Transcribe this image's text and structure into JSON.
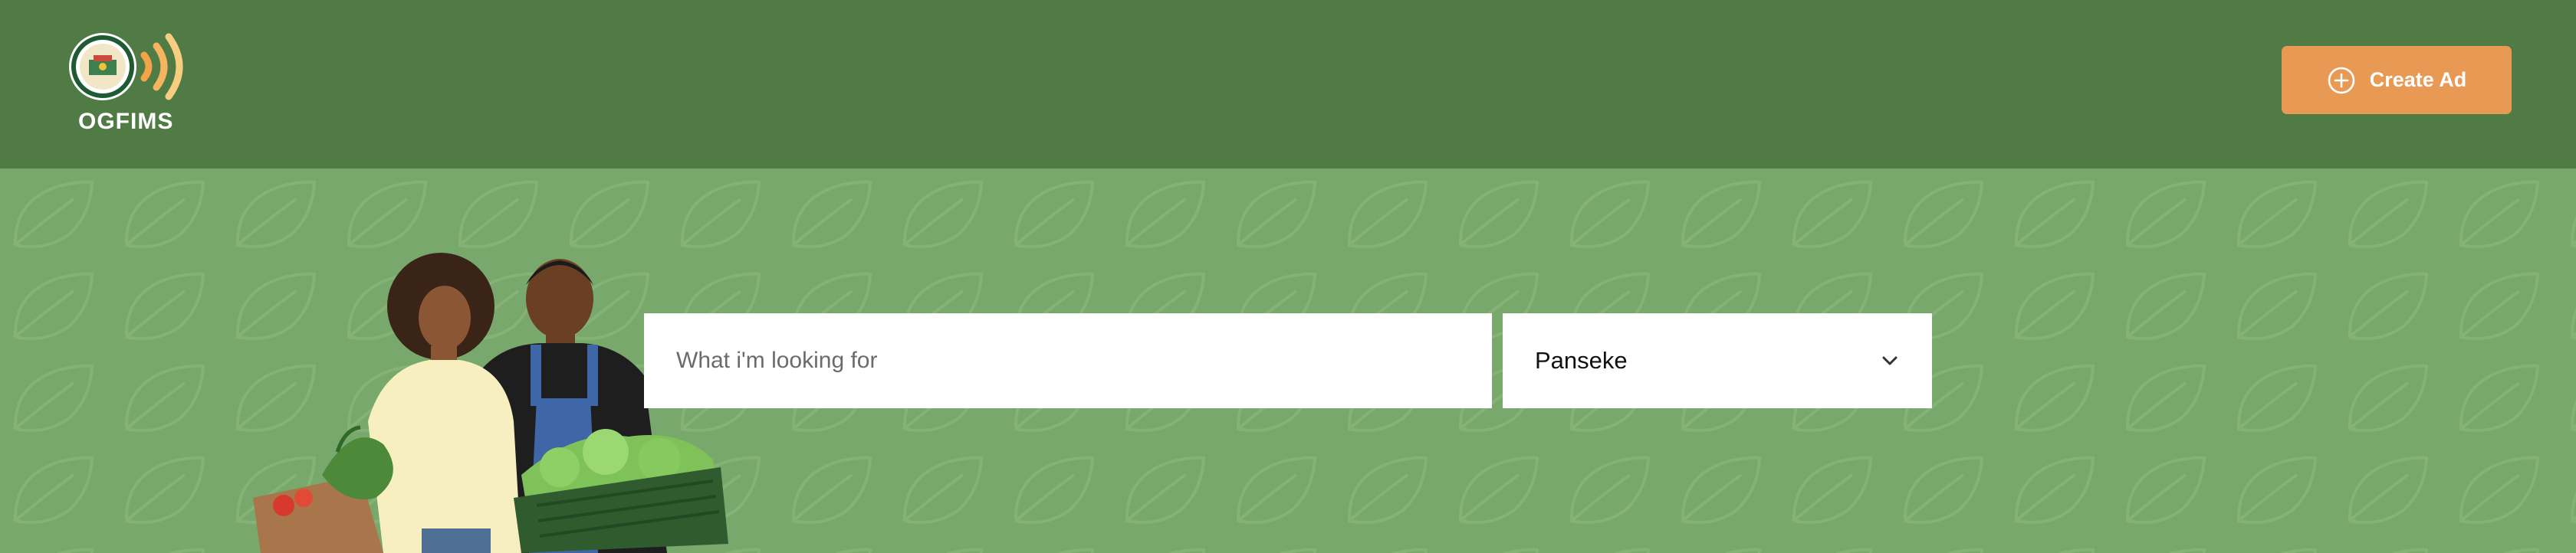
{
  "header": {
    "brand_name": "OGFIMS",
    "create_ad_label": "Create Ad"
  },
  "search": {
    "placeholder": "What i'm looking for",
    "value": ""
  },
  "location": {
    "selected": "Panseke"
  },
  "icons": {
    "create_ad": "plus-circle-icon",
    "location_dropdown": "chevron-down-icon",
    "logo": "ogfims-logo"
  },
  "colors": {
    "header_bg": "#517b45",
    "hero_bg": "#78a86b",
    "accent": "#e89a55"
  }
}
